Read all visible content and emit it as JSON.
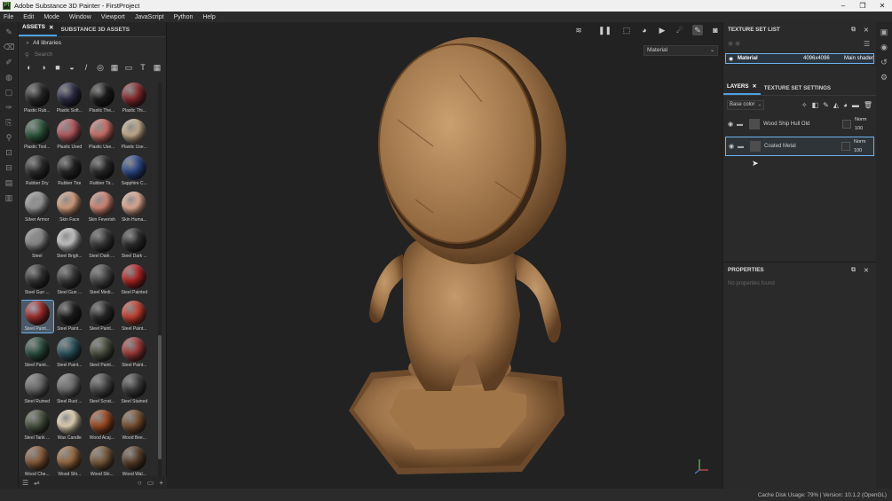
{
  "window": {
    "title": "Adobe Substance 3D Painter - FirstProject",
    "logo": "Pt",
    "controls": [
      "–",
      "❐",
      "✕"
    ]
  },
  "menu": [
    "File",
    "Edit",
    "Mode",
    "Window",
    "Viewport",
    "JavaScript",
    "Python",
    "Help"
  ],
  "assets": {
    "tabs": [
      "ASSETS",
      "SUBSTANCE 3D ASSETS"
    ],
    "library": "All libraries",
    "search_placeholder": "Search",
    "materials": [
      {
        "name": "Plastic Rub...",
        "color": "#2a2a2a"
      },
      {
        "name": "Plastic Soft...",
        "color": "#2c2c48"
      },
      {
        "name": "Plastic The...",
        "color": "#1c1c1c"
      },
      {
        "name": "Plastic Thi...",
        "color": "#8a2a2e"
      },
      {
        "name": "Plastic Tool...",
        "color": "#2f5a3e"
      },
      {
        "name": "Plastic Used",
        "color": "#b85a60"
      },
      {
        "name": "Plastic Use...",
        "color": "#d07068"
      },
      {
        "name": "Plastic Use...",
        "color": "#c8b090"
      },
      {
        "name": "Rubber Dry",
        "color": "#2e2e2e"
      },
      {
        "name": "Rubber Tire",
        "color": "#262626"
      },
      {
        "name": "Rubber Tir...",
        "color": "#2a2a2a"
      },
      {
        "name": "Sapphire C...",
        "color": "#2c4a8a"
      },
      {
        "name": "Silver Armor",
        "color": "#9a9a9a"
      },
      {
        "name": "Skin Face",
        "color": "#d8a080"
      },
      {
        "name": "Skin Feverish",
        "color": "#d88a78"
      },
      {
        "name": "Skin Huma...",
        "color": "#e8b098"
      },
      {
        "name": "Steel",
        "color": "#8a8a8a"
      },
      {
        "name": "Steel Brigh...",
        "color": "#c8c8c8"
      },
      {
        "name": "Steel Dark ...",
        "color": "#3a3a3a"
      },
      {
        "name": "Steel Dark ...",
        "color": "#2e2e2e"
      },
      {
        "name": "Steel Gun ...",
        "color": "#333333"
      },
      {
        "name": "Steel Gun ...",
        "color": "#3a3a3a"
      },
      {
        "name": "Steel Medi...",
        "color": "#4a4a4a"
      },
      {
        "name": "Steel Painted",
        "color": "#b02424"
      },
      {
        "name": "Steel Paint...",
        "color": "#a02a2a",
        "selected": true
      },
      {
        "name": "Steel Paint...",
        "color": "#1e1e1e"
      },
      {
        "name": "Steel Paint...",
        "color": "#2a2a2a"
      },
      {
        "name": "Steel Paint...",
        "color": "#c8402e"
      },
      {
        "name": "Steel Paint...",
        "color": "#2c5040"
      },
      {
        "name": "Steel Paint...",
        "color": "#2c5560"
      },
      {
        "name": "Steel Paint...",
        "color": "#4a5040"
      },
      {
        "name": "Steel Paint...",
        "color": "#a03a3a"
      },
      {
        "name": "Steel Ruined",
        "color": "#6a6a6a"
      },
      {
        "name": "Steel Rust ...",
        "color": "#6e6e6e"
      },
      {
        "name": "Steel Scrat...",
        "color": "#4a4a4a"
      },
      {
        "name": "Steel Stained",
        "color": "#3e3e3e"
      },
      {
        "name": "Steel Tank ...",
        "color": "#4a5440"
      },
      {
        "name": "Wax Candle",
        "color": "#e8d8b8"
      },
      {
        "name": "Wood Acaj...",
        "color": "#a04a20"
      },
      {
        "name": "Wood Bee...",
        "color": "#7a5030"
      },
      {
        "name": "Wood Che...",
        "color": "#8a5a38"
      },
      {
        "name": "Wood Shi...",
        "color": "#9a6a3e"
      },
      {
        "name": "Wood Shi...",
        "color": "#7a5a3a"
      },
      {
        "name": "Wood Wal...",
        "color": "#5a3e2a"
      }
    ]
  },
  "viewport": {
    "material_dropdown": "Material"
  },
  "texture_set_list": {
    "title": "TEXTURE SET LIST",
    "row": {
      "name": "Material",
      "resolution": "4096x4096",
      "shader": "Main shader"
    }
  },
  "layers": {
    "tabs": [
      "LAYERS",
      "TEXTURE SET SETTINGS"
    ],
    "channel": "Base color",
    "items": [
      {
        "name": "Wood Ship Hull Old",
        "blend": "Norm",
        "opacity": "100"
      },
      {
        "name": "Coated Metal",
        "blend": "Norm",
        "opacity": "100"
      }
    ]
  },
  "properties": {
    "title": "PROPERTIES",
    "empty": "No properties found"
  },
  "status": "Cache Disk Usage:   79% | Version: 10.1.2 (OpenGL)"
}
